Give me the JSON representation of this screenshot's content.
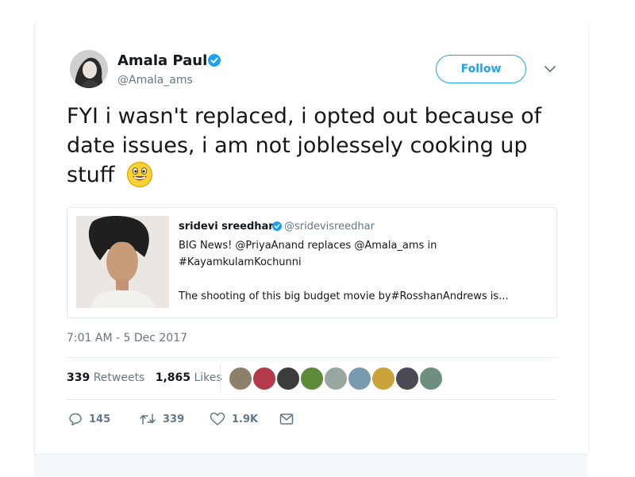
{
  "author": {
    "name": "Amala Paul",
    "handle": "@Amala_ams",
    "verified": true
  },
  "follow_button": {
    "label": "Follow"
  },
  "tweet": {
    "text": "FYI i wasn't replaced, i opted out because of date issues, i am not joblessely cooking up stuff",
    "emoji": "grinning-winking-face"
  },
  "quoted_tweet": {
    "name": "sridevi sreedhar",
    "handle": "@sridevisreedhar",
    "verified": true,
    "line1": "BIG News!  @PriyaAnand replaces @Amala_ams  in",
    "line2": "#KayamkulamKochunni",
    "line3": "The shooting of this big budget movie by#RosshanAndrews  is..."
  },
  "timestamp": "7:01 AM - 5 Dec 2017",
  "stats": {
    "retweets_count": "339",
    "retweets_label": "Retweets",
    "likes_count": "1,865",
    "likes_label": "Likes"
  },
  "actions": {
    "reply_count": "145",
    "retweet_count": "339",
    "like_count": "1.9K"
  },
  "colors": {
    "accent": "#1da1f2",
    "secondary_text": "#657786",
    "border": "#e6ecf0"
  },
  "icons": [
    "verified-badge-icon",
    "chevron-down-icon",
    "reply-icon",
    "retweet-icon",
    "heart-icon",
    "envelope-icon"
  ]
}
